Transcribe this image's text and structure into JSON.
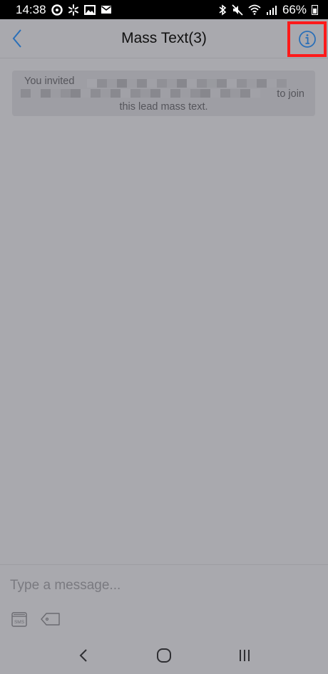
{
  "status_bar": {
    "time": "14:38",
    "battery": "66%",
    "left_icons": [
      "circle-dot-icon",
      "walmart-spark-icon",
      "image-icon",
      "mail-icon"
    ],
    "right_icons": [
      "bluetooth-icon",
      "mute-icon",
      "wifi-icon",
      "signal-icon",
      "battery-icon"
    ]
  },
  "header": {
    "title": "Mass Text(3)",
    "back_icon": "chevron-left-icon",
    "info_icon": "info-circle-icon",
    "highlight_color": "#ff1a1a",
    "accent_color": "#2a6fb8"
  },
  "notice": {
    "line1": "You invited",
    "line2_suffix": "to join",
    "line3": "this lead mass text."
  },
  "composer": {
    "placeholder": "Type a message...",
    "value": "",
    "sms_icon": "sms-icon",
    "sms_label": "SMS",
    "tag_icon": "tag-icon"
  },
  "nav_bar": {
    "back_icon": "back-chevron-icon",
    "home_icon": "home-icon",
    "recents_icon": "recents-icon"
  }
}
